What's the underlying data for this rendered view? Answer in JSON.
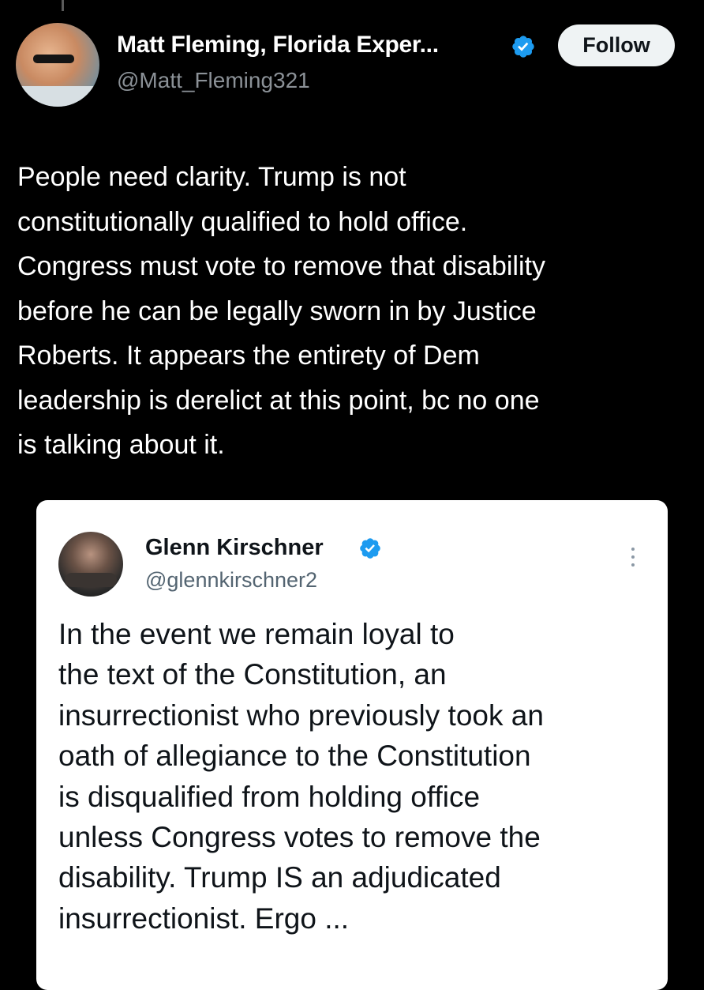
{
  "author": {
    "display_name": "Matt Fleming, Florida Exper...",
    "handle": "@Matt_Fleming321",
    "follow_label": "Follow"
  },
  "tweet": {
    "lines": [
      "People need clarity. Trump is not",
      "constitutionally qualified to hold office.",
      "Congress must vote to remove that disability",
      "before he can be legally sworn in by Justice",
      "Roberts. It appears the entirety of Dem",
      "leadership is derelict at this point, bc no one",
      "is talking about it."
    ]
  },
  "quoted_tweet": {
    "display_name": "Glenn Kirschner",
    "handle": "@glennkirschner2",
    "lines": [
      "In the event we remain loyal to",
      "the text of the Constitution, an",
      "insurrectionist who previously took an",
      "oath of allegiance to the Constitution",
      "is disqualified from holding office",
      "unless Congress votes to remove the",
      "disability. Trump IS an adjudicated",
      "insurrectionist. Ergo ..."
    ]
  },
  "icons": {
    "verified": "verified-badge-icon",
    "more": "more-vertical-icon"
  },
  "colors": {
    "background": "#000000",
    "verified_blue": "#1d9bf0",
    "follow_button_bg": "#eff3f4",
    "secondary_text_dark": "#8b9197",
    "secondary_text_light": "#536471"
  }
}
